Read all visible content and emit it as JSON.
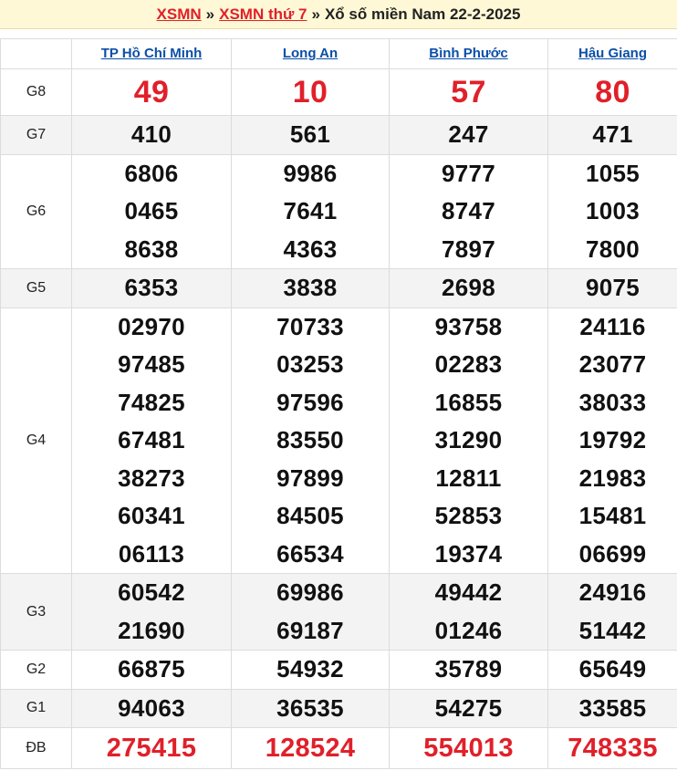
{
  "header": {
    "link1": "XSMN",
    "sep1": "»",
    "link2": "XSMN thứ 7",
    "sep2": "»",
    "title": "Xổ số miền Nam 22-2-2025"
  },
  "provinces": [
    "TP Hồ Chí Minh",
    "Long An",
    "Bình Phước",
    "Hậu Giang"
  ],
  "prizes": [
    {
      "label": "G8",
      "style": "big",
      "shade": false,
      "values": [
        [
          "49"
        ],
        [
          "10"
        ],
        [
          "57"
        ],
        [
          "80"
        ]
      ]
    },
    {
      "label": "G7",
      "style": "normal",
      "shade": true,
      "values": [
        [
          "410"
        ],
        [
          "561"
        ],
        [
          "247"
        ],
        [
          "471"
        ]
      ]
    },
    {
      "label": "G6",
      "style": "normal",
      "shade": false,
      "values": [
        [
          "6806",
          "0465",
          "8638"
        ],
        [
          "9986",
          "7641",
          "4363"
        ],
        [
          "9777",
          "8747",
          "7897"
        ],
        [
          "1055",
          "1003",
          "7800"
        ]
      ]
    },
    {
      "label": "G5",
      "style": "normal",
      "shade": true,
      "values": [
        [
          "6353"
        ],
        [
          "3838"
        ],
        [
          "2698"
        ],
        [
          "9075"
        ]
      ]
    },
    {
      "label": "G4",
      "style": "normal",
      "shade": false,
      "values": [
        [
          "02970",
          "97485",
          "74825",
          "67481",
          "38273",
          "60341",
          "06113"
        ],
        [
          "70733",
          "03253",
          "97596",
          "83550",
          "97899",
          "84505",
          "66534"
        ],
        [
          "93758",
          "02283",
          "16855",
          "31290",
          "12811",
          "52853",
          "19374"
        ],
        [
          "24116",
          "23077",
          "38033",
          "19792",
          "21983",
          "15481",
          "06699"
        ]
      ]
    },
    {
      "label": "G3",
      "style": "normal",
      "shade": true,
      "values": [
        [
          "60542",
          "21690"
        ],
        [
          "69986",
          "69187"
        ],
        [
          "49442",
          "01246"
        ],
        [
          "24916",
          "51442"
        ]
      ]
    },
    {
      "label": "G2",
      "style": "normal",
      "shade": false,
      "values": [
        [
          "66875"
        ],
        [
          "54932"
        ],
        [
          "35789"
        ],
        [
          "65649"
        ]
      ]
    },
    {
      "label": "G1",
      "style": "normal",
      "shade": true,
      "values": [
        [
          "94063"
        ],
        [
          "36535"
        ],
        [
          "54275"
        ],
        [
          "33585"
        ]
      ]
    },
    {
      "label": "ĐB",
      "style": "db",
      "shade": false,
      "values": [
        [
          "275415"
        ],
        [
          "128524"
        ],
        [
          "554013"
        ],
        [
          "748335"
        ]
      ]
    }
  ],
  "colors": {
    "red": "#e0202a",
    "blue": "#0b4fa8",
    "header_bg": "#fff8d6",
    "shade": "#f3f3f3"
  }
}
